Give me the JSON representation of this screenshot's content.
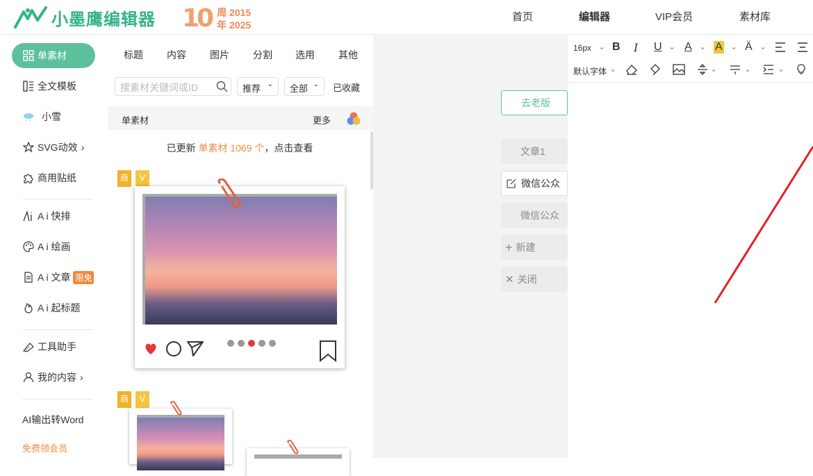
{
  "app": {
    "name": "小墨鹰编辑器",
    "anniv_ten": "10",
    "anniv_line1": "周 2015",
    "anniv_line2": "年 2025"
  },
  "topnav": [
    {
      "label": "首页",
      "active": false
    },
    {
      "label": "编辑器",
      "active": true
    },
    {
      "label": "VIP会员",
      "active": false
    },
    {
      "label": "素材库",
      "active": false
    }
  ],
  "leftnav": {
    "active": "单素材",
    "items": [
      "全文模板",
      "小雪",
      "SVG动效",
      "商用贴纸",
      "A i 快排",
      "A i 绘画",
      "A i 文章",
      "A i 起标题",
      "工具助手",
      "我的内容",
      "AI输出转Word",
      "免费领会员"
    ],
    "badge": "限免",
    "chevron": "›"
  },
  "panel": {
    "tabs": [
      "标题",
      "内容",
      "图片",
      "分割",
      "选用",
      "其他"
    ],
    "search_placeholder": "搜素材关键词或ID",
    "sort": "推荐",
    "scope": "全部",
    "favorites": "已收藏",
    "section_title": "单素材",
    "more": "更多",
    "notice_pre": "已更新 ",
    "notice_highlight": "单素材 1069 个",
    "notice_post": "，点击查看",
    "tag_shang": "商",
    "tag_v": "V"
  },
  "side_buttons": {
    "old_version": "去老版",
    "article1": "文章1",
    "wechat_edit": "微信公众",
    "wechat2": "微信公众",
    "new": "新建",
    "close": "关闭"
  },
  "toolbar": {
    "font_size": "16px",
    "font_family": "默认字体"
  },
  "colors": {
    "brand": "#34b38a",
    "accent": "#5cc19b",
    "orange": "#f08a40",
    "like_red": "#e53935"
  }
}
